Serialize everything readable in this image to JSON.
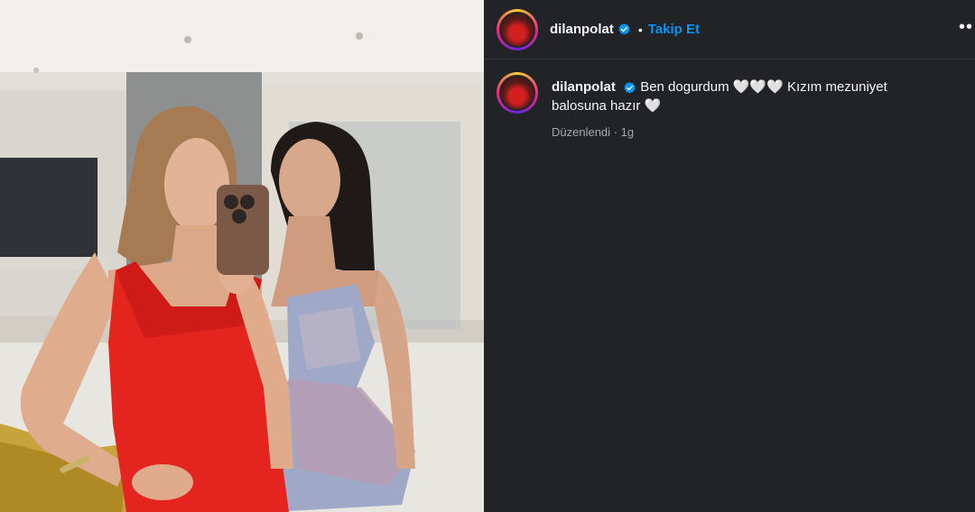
{
  "post": {
    "username": "dilanpolat",
    "follow_label": "Takip Et",
    "separator": "•",
    "more_label": "••",
    "caption_text": "Ben dogurdum 🤍🤍🤍 Kızım mezuniyet balosuna hazır 🤍",
    "edited_label": "Düzenlendi",
    "meta_separator": " · ",
    "time_label": "1g"
  },
  "colors": {
    "panel_bg": "#222327",
    "accent": "#0095f6",
    "verified": "#0095f6",
    "muted_text": "#a8a8a8"
  },
  "icons": {
    "verified": "verified-badge-icon",
    "more": "more-options-icon"
  }
}
